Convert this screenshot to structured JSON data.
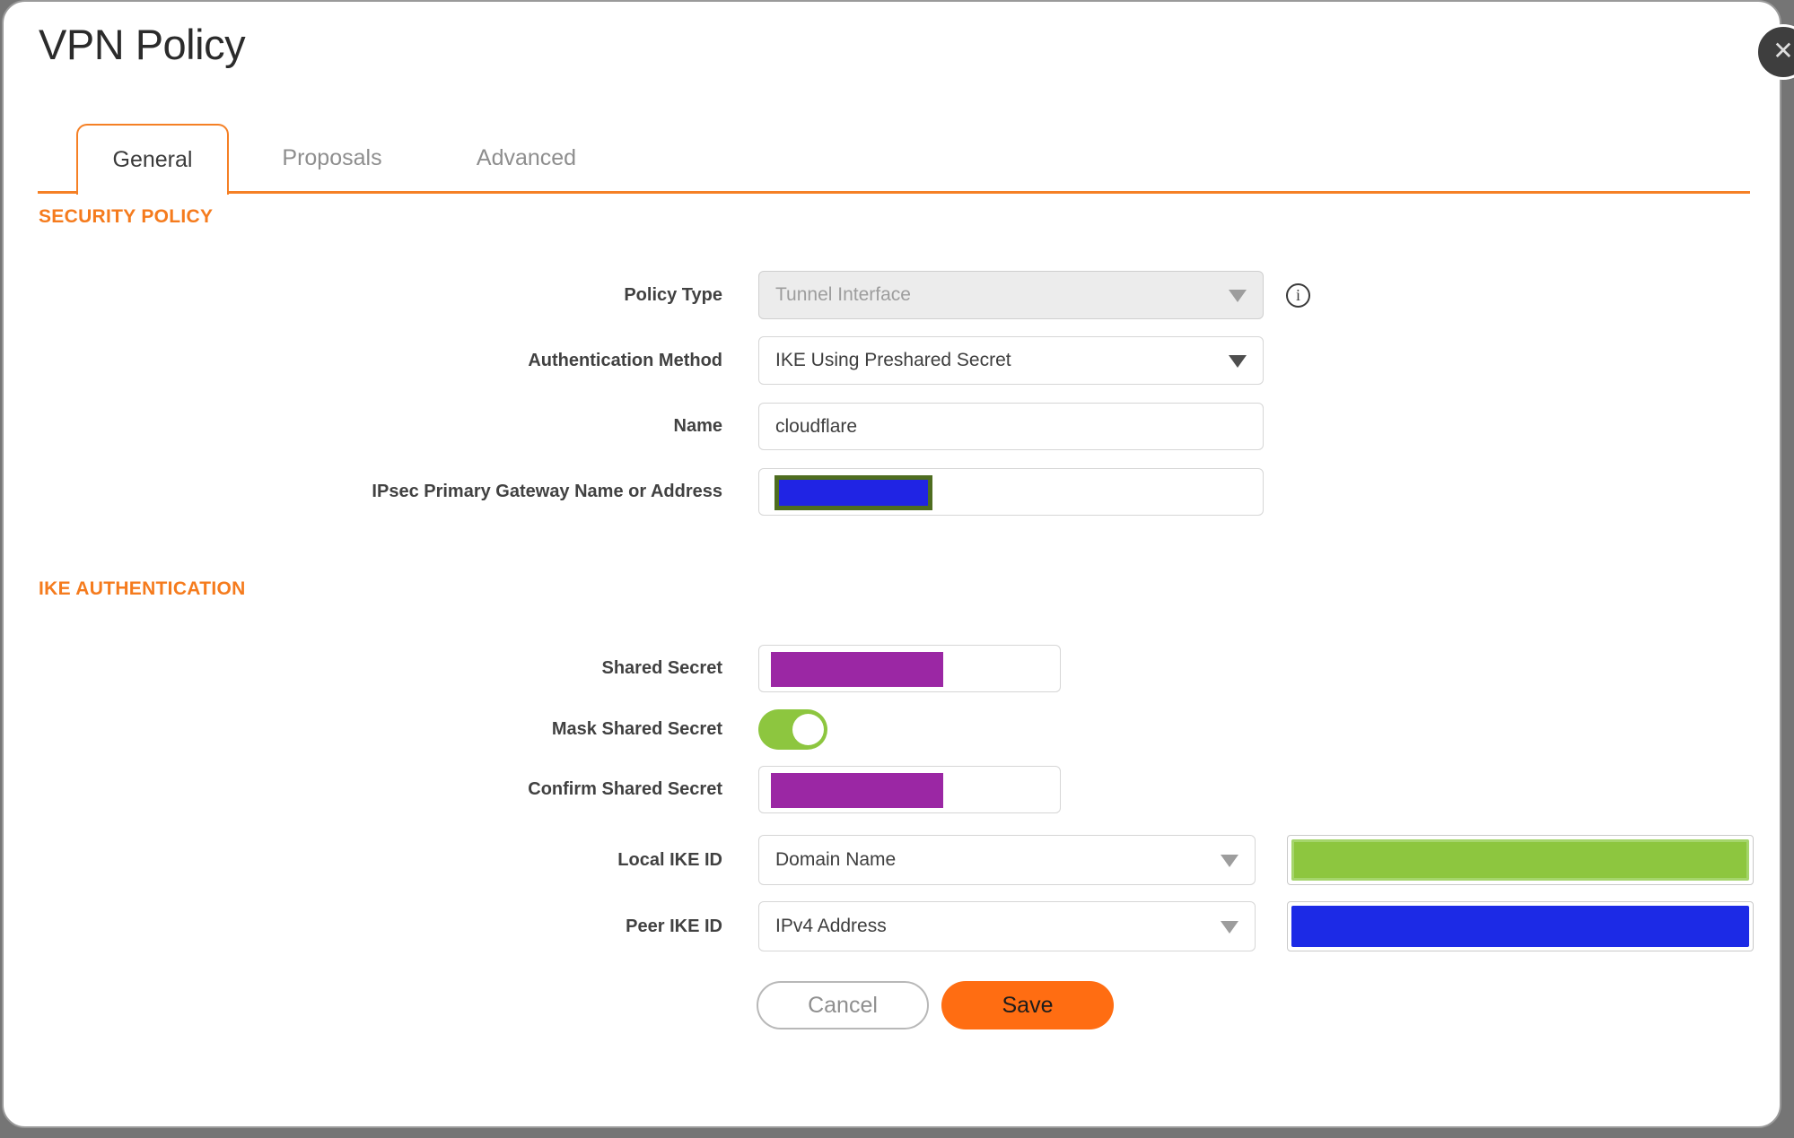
{
  "dialog": {
    "title": "VPN Policy",
    "close_icon": "✕"
  },
  "tabs": [
    {
      "label": "General",
      "active": true
    },
    {
      "label": "Proposals",
      "active": false
    },
    {
      "label": "Advanced",
      "active": false
    }
  ],
  "sections": {
    "security_policy": "SECURITY POLICY",
    "ike_authentication": "IKE AUTHENTICATION"
  },
  "fields": {
    "policy_type": {
      "label": "Policy Type",
      "value": "Tunnel Interface",
      "disabled": true
    },
    "authentication_method": {
      "label": "Authentication Method",
      "value": "IKE Using Preshared Secret"
    },
    "name": {
      "label": "Name",
      "value": "cloudflare"
    },
    "ipsec_primary_gateway": {
      "label": "IPsec Primary Gateway Name or Address",
      "value_redacted": true
    },
    "shared_secret": {
      "label": "Shared Secret",
      "value_redacted": true
    },
    "mask_shared_secret": {
      "label": "Mask Shared Secret",
      "enabled": true
    },
    "confirm_shared_secret": {
      "label": "Confirm Shared Secret",
      "value_redacted": true
    },
    "local_ike_id": {
      "label": "Local IKE ID",
      "value": "Domain Name",
      "id_value_redacted": true
    },
    "peer_ike_id": {
      "label": "Peer IKE ID",
      "value": "IPv4 Address",
      "id_value_redacted": true
    }
  },
  "icons": {
    "info": "i"
  },
  "buttons": {
    "cancel": "Cancel",
    "save": "Save"
  },
  "colors": {
    "accent_orange": "#f57b1d",
    "save_orange": "#ff6d12",
    "toggle_green": "#8dc63f",
    "redaction_purple": "#9b27a4",
    "redaction_blue": "#1c2ae6",
    "redaction_green": "#8dc63f",
    "redaction_blue_border_green": "#4e6d20"
  }
}
